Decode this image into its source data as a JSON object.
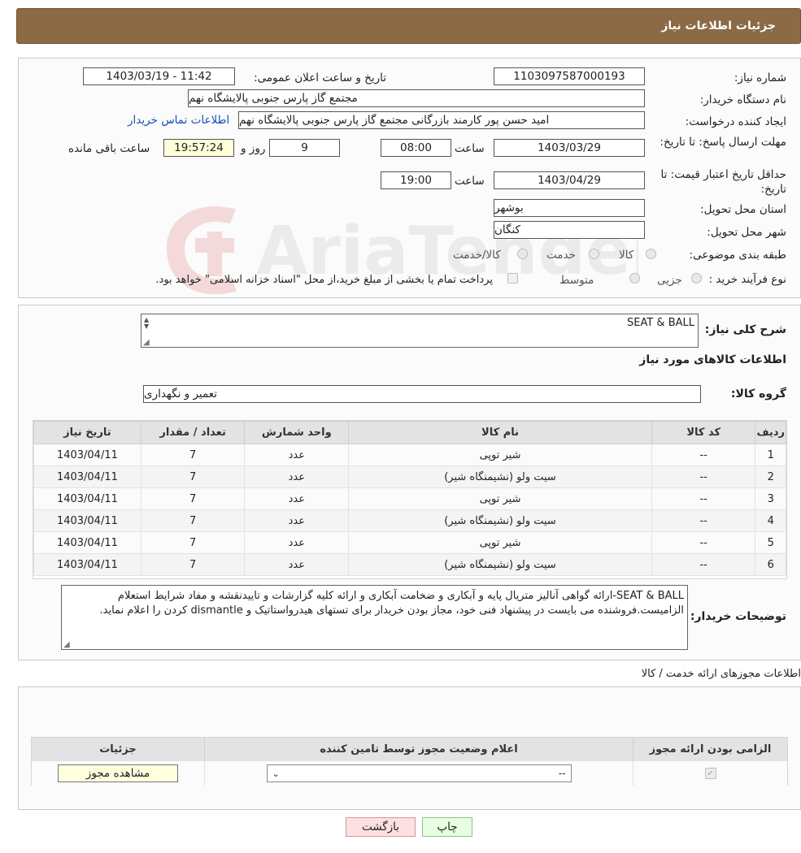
{
  "header": {
    "title": "جزئیات اطلاعات نیاز"
  },
  "form": {
    "need_number_label": "شماره نیاز:",
    "need_number": "1103097587000193",
    "announce_label": "تاریخ و ساعت اعلان عمومی:",
    "announce_value": "1403/03/19 - 11:42",
    "buyer_label": "نام دستگاه خریدار:",
    "buyer_value": "مجتمع گاز پارس جنوبی  پالایشگاه نهم",
    "creator_label": "ایجاد کننده درخواست:",
    "creator_value": "امید حسن پور کارمند بازرگانی مجتمع گاز پارس جنوبی  پالایشگاه نهم",
    "contact_link": "اطلاعات تماس خریدار",
    "deadline_label": "مهلت ارسال پاسخ: تا تاریخ:",
    "deadline_date": "1403/03/29",
    "time_label": "ساعت",
    "deadline_time": "08:00",
    "days_value": "9",
    "days_label": "روز و",
    "remaining_time": "19:57:24",
    "remaining_label": "ساعت باقی مانده",
    "validity_label": "حداقل تاریخ اعتبار قیمت: تا تاریخ:",
    "validity_date": "1403/04/29",
    "validity_time": "19:00",
    "province_label": "استان محل تحویل:",
    "province_value": "بوشهر",
    "city_label": "شهر محل تحویل:",
    "city_value": "کنگان",
    "category_label": "طبقه بندی موضوعی:",
    "category_options": [
      "کالا",
      "خدمت",
      "کالا/خدمت"
    ],
    "purchase_label": "نوع فرآیند خرید :",
    "purchase_options": [
      "جزیی",
      "متوسط"
    ],
    "purchase_note": "پرداخت تمام یا بخشی از مبلغ خرید،از محل \"اسناد خزانه اسلامی\" خواهد بود."
  },
  "watermark": {
    "text": "AriaTender.neT"
  },
  "general": {
    "desc_label": "شرح کلی نیاز:",
    "desc_value": "SEAT & BALL",
    "goods_title": "اطلاعات کالاهای مورد نیاز",
    "group_label": "گروه کالا:",
    "group_value": "تعمیر و نگهداری"
  },
  "items_table": {
    "headers": [
      "ردیف",
      "کد کالا",
      "نام کالا",
      "واحد شمارش",
      "تعداد / مقدار",
      "تاریخ نیاز"
    ],
    "rows": [
      [
        "1",
        "--",
        "شیر توپی",
        "عدد",
        "7",
        "1403/04/11"
      ],
      [
        "2",
        "--",
        "سیت ولو (نشیمنگاه شیر)",
        "عدد",
        "7",
        "1403/04/11"
      ],
      [
        "3",
        "--",
        "شیر توپی",
        "عدد",
        "7",
        "1403/04/11"
      ],
      [
        "4",
        "--",
        "سیت ولو (نشیمنگاه شیر)",
        "عدد",
        "7",
        "1403/04/11"
      ],
      [
        "5",
        "--",
        "شیر توپی",
        "عدد",
        "7",
        "1403/04/11"
      ],
      [
        "6",
        "--",
        "سیت ولو (نشیمنگاه شیر)",
        "عدد",
        "7",
        "1403/04/11"
      ]
    ]
  },
  "buyer_notes": {
    "label": "توضیحات خریدار:",
    "text": "SEAT & BALL-ارائه گواهی آنالیز متریال پایه و آبکاری و ضخامت آبکاری و ارائه کلیه گزارشات و تاییدنقشه و مفاد شرایط استعلام الزامیست.فروشنده می بایست در پیشنهاد فنی خود، مجاز بودن خریدار برای تستهای هیدرواستاتیک و dismantle کردن را اعلام نماید."
  },
  "permits": {
    "title": "اطلاعات مجوزهای ارائه خدمت / کالا",
    "headers": [
      "الزامی بودن ارائه مجوز",
      "اعلام وضعیت مجوز توسط تامین کننده",
      "جزئیات"
    ],
    "select_value": "--",
    "view_button": "مشاهده مجوز"
  },
  "footer": {
    "print_button": "چاپ",
    "back_button": "بازگشت"
  }
}
